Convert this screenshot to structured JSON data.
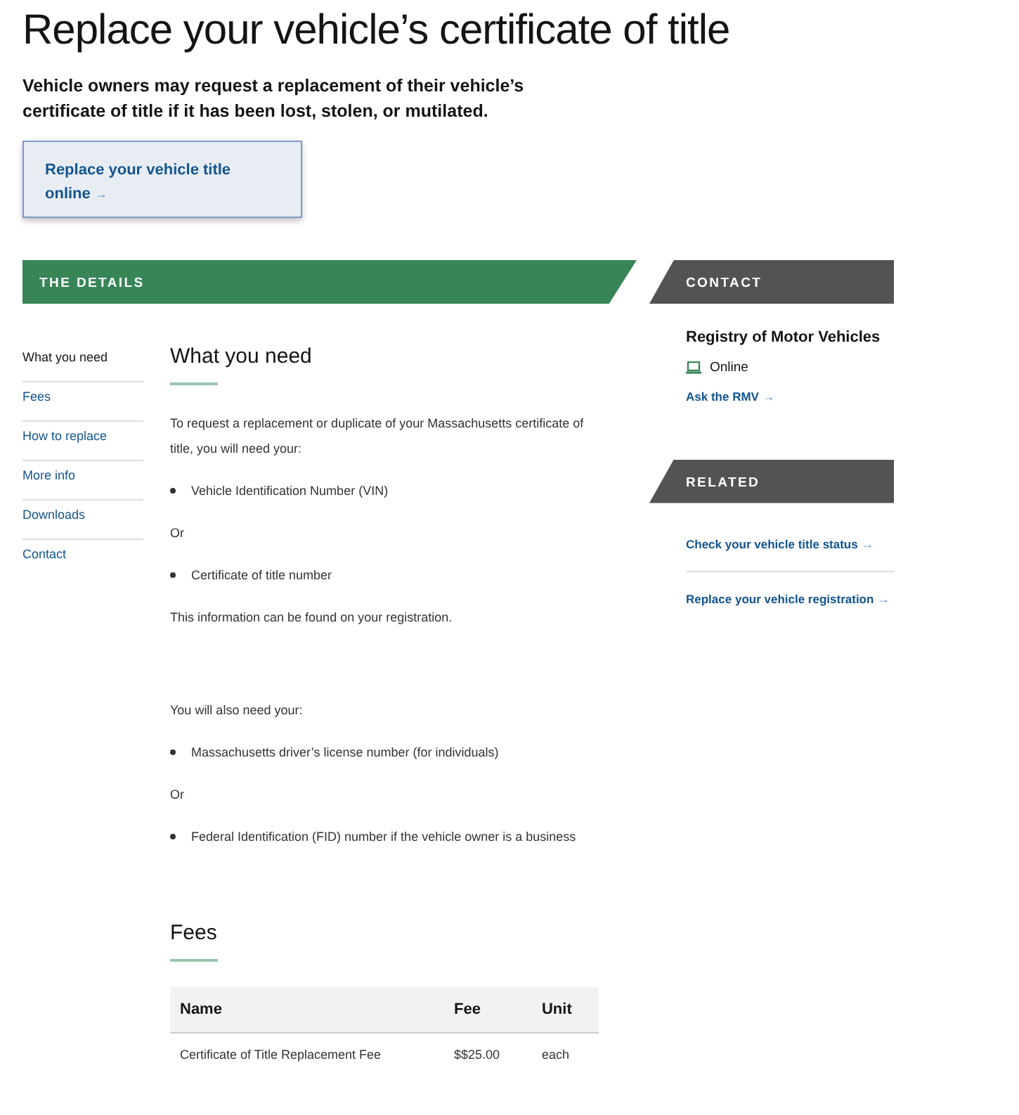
{
  "page_title": "Replace your vehicle’s certificate of title",
  "intro": "Vehicle owners may request a replacement of their vehicle’s certificate of title if it has been lost, stolen, or mutilated.",
  "cta": {
    "label": "Replace your vehicle title online",
    "arrow": "→"
  },
  "details_banner": "THE DETAILS",
  "nav": [
    {
      "label": "What you need",
      "selected": true
    },
    {
      "label": "Fees",
      "selected": false
    },
    {
      "label": "How to replace",
      "selected": false
    },
    {
      "label": "More info",
      "selected": false
    },
    {
      "label": "Downloads",
      "selected": false
    },
    {
      "label": "Contact",
      "selected": false
    }
  ],
  "what_you_need": {
    "heading": "What you need",
    "blocks": [
      {
        "kind": "text",
        "text": "To request a replacement or duplicate of your Massachusetts certificate of title, you will need your:"
      },
      {
        "kind": "bullet",
        "text": "Vehicle Identification Number (VIN)"
      },
      {
        "kind": "text",
        "text": "Or"
      },
      {
        "kind": "bullet",
        "text": "Certificate of title number"
      },
      {
        "kind": "text",
        "text": "This information can be found on your registration."
      },
      {
        "kind": "gap"
      },
      {
        "kind": "text",
        "text": "You will also need your:"
      },
      {
        "kind": "bullet",
        "text": "Massachusetts driver’s license number (for individuals)"
      },
      {
        "kind": "text",
        "text": " Or"
      },
      {
        "kind": "bullet",
        "text": "Federal Identification (FID) number if the vehicle owner is a business"
      }
    ]
  },
  "fees": {
    "heading": "Fees",
    "table": {
      "columns": [
        "Name",
        "Fee",
        "Unit"
      ],
      "rows": [
        [
          "Certificate of Title Replacement Fee",
          "$$25.00",
          "each"
        ]
      ]
    }
  },
  "contact": {
    "banner": "CONTACT",
    "org": "Registry of Motor Vehicles",
    "online": "Online",
    "link": {
      "label": "Ask the RMV",
      "arrow": "→"
    }
  },
  "related": {
    "banner": "RELATED",
    "links": [
      {
        "label": "Check your vehicle title status",
        "arrow": "→"
      },
      {
        "label": "Replace your vehicle registration",
        "arrow": "→"
      }
    ]
  }
}
